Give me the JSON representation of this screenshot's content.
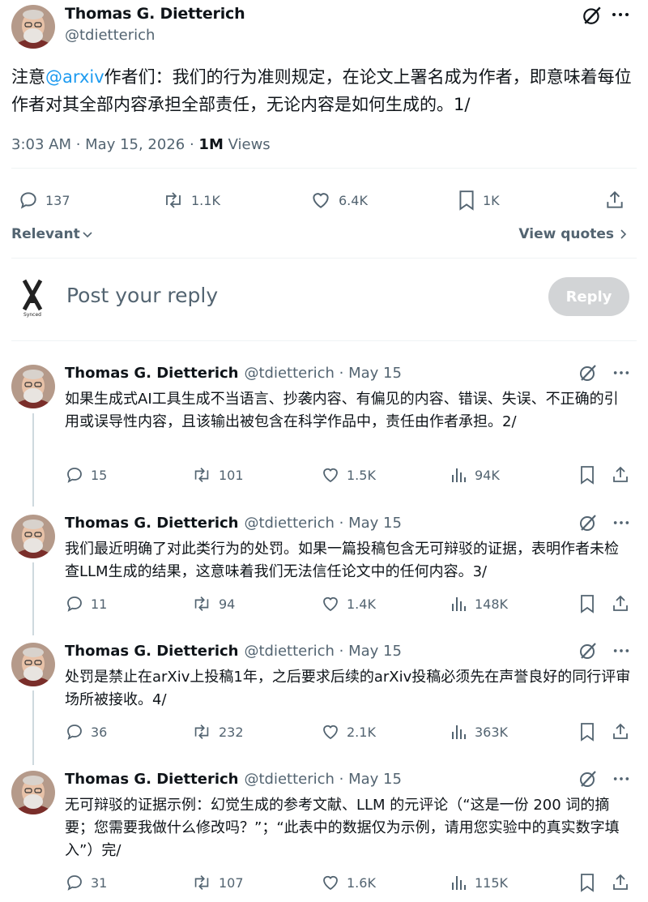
{
  "main_tweet": {
    "author_name": "Thomas G. Dietterich",
    "handle": "@tdietterich",
    "text_prefix": "注意",
    "mention": "@arxiv",
    "text_rest": "作者们：我们的行为准则规定，在论文上署名成为作者，即意味着每位作者对其全部内容承担全部责任，无论内容是如何生成的。1/",
    "time": "3:03 AM · May 15, 2026 · ",
    "views_count": "1M",
    "views_label": " Views",
    "replies": "137",
    "reposts": "1.1K",
    "likes": "6.4K",
    "bookmarks": "1K"
  },
  "sort": {
    "relevant_label": "Relevant",
    "view_quotes_label": "View quotes"
  },
  "compose": {
    "placeholder": "Post your reply",
    "reply_button": "Reply",
    "logo_text": "Synced"
  },
  "thread": [
    {
      "name": "Thomas G. Dietterich",
      "handle": "@tdietterich · May 15",
      "text": "如果生成式AI工具生成不当语言、抄袭内容、有偏见的内容、错误、失误、不正确的引用或误导性内容，且该输出被包含在科学作品中，责任由作者承担。2/",
      "replies": "15",
      "reposts": "101",
      "likes": "1.5K",
      "views": "94K"
    },
    {
      "name": "Thomas G. Dietterich",
      "handle": "@tdietterich · May 15",
      "text": "我们最近明确了对此类行为的处罚。如果一篇投稿包含无可辩驳的证据，表明作者未检查LLM生成的结果，这意味着我们无法信任论文中的任何内容。3/",
      "replies": "11",
      "reposts": "94",
      "likes": "1.4K",
      "views": "148K"
    },
    {
      "name": "Thomas G. Dietterich",
      "handle": "@tdietterich · May 15",
      "text": "处罚是禁止在arXiv上投稿1年，之后要求后续的arXiv投稿必须先在声誉良好的同行评审场所被接收。4/",
      "replies": "36",
      "reposts": "232",
      "likes": "2.1K",
      "views": "363K"
    },
    {
      "name": "Thomas G. Dietterich",
      "handle": "@tdietterich · May 15",
      "text": "无可辩驳的证据示例：幻觉生成的参考文献、LLM 的元评论（“这是一份 200 词的摘要；您需要我做什么修改吗？”；“此表中的数据仅为示例，请用您实验中的真实数字填入”）完/",
      "replies": "31",
      "reposts": "107",
      "likes": "1.6K",
      "views": "115K"
    }
  ]
}
